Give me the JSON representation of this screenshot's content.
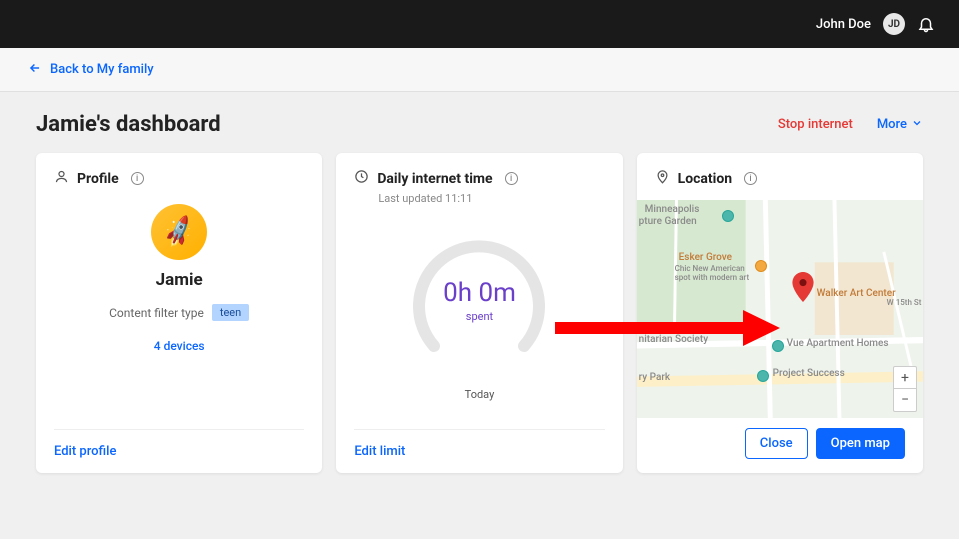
{
  "topbar": {
    "username": "John Doe",
    "avatar_initials": "JD"
  },
  "back_link": {
    "label": "Back to My family"
  },
  "page": {
    "title": "Jamie's dashboard",
    "stop_label": "Stop internet",
    "more_label": "More"
  },
  "profile_card": {
    "title": "Profile",
    "name": "Jamie",
    "filter_label": "Content filter type",
    "filter_value": "teen",
    "devices_link": "4 devices",
    "edit_label": "Edit profile"
  },
  "usage_card": {
    "title": "Daily internet time",
    "last_updated": "Last updated 11:11",
    "time_value": "0h 0m",
    "spent_label": "spent",
    "period_label": "Today",
    "edit_label": "Edit limit"
  },
  "location_card": {
    "title": "Location",
    "close_label": "Close",
    "open_label": "Open map",
    "zoom_in": "+",
    "zoom_out": "−",
    "places": {
      "p1": "Minneapolis",
      "p2": "pture Garden",
      "p3": "Esker Grove",
      "p3_sub1": "Chic New American",
      "p3_sub2": "spot with modern art",
      "p4": "Walker Art Center",
      "p5": "nitarian Society",
      "p6": "Vue Apartment Homes",
      "p7": "Project Success",
      "p8": "ry Park",
      "p9": "W 15th St"
    }
  }
}
